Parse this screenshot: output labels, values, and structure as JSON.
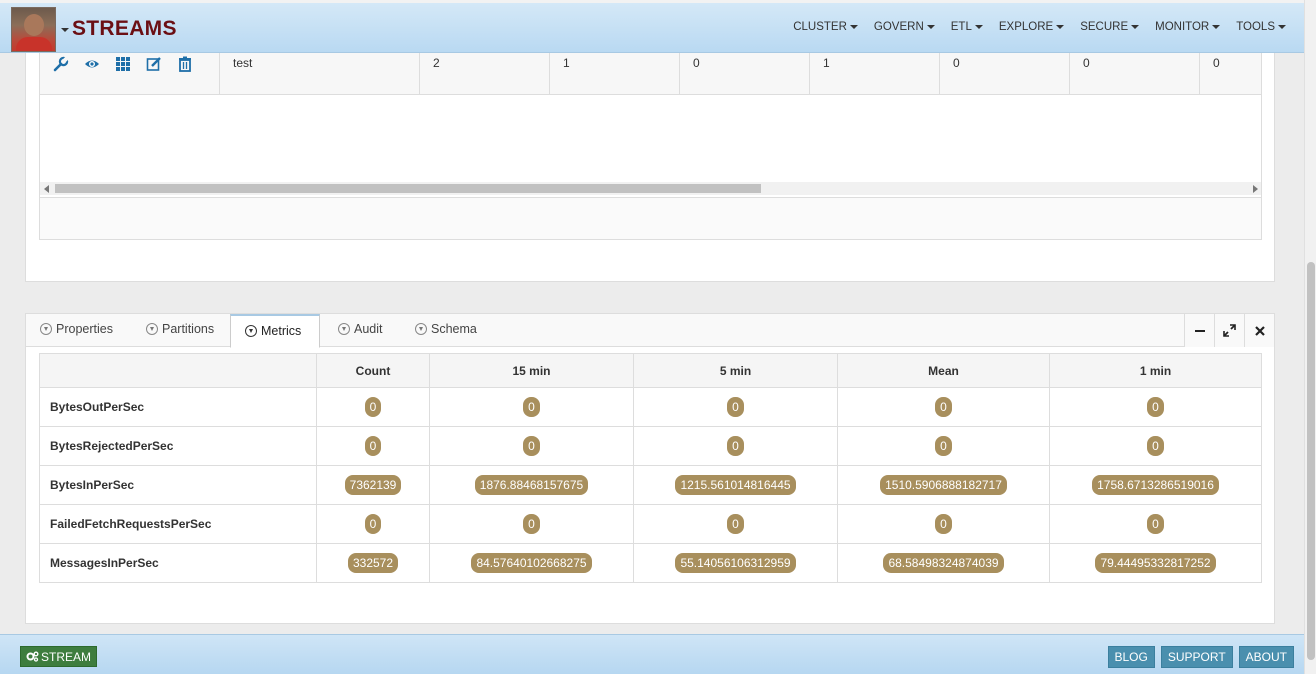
{
  "header": {
    "brand": "STREAMS",
    "menu": [
      {
        "label": "CLUSTER"
      },
      {
        "label": "GOVERN"
      },
      {
        "label": "ETL"
      },
      {
        "label": "EXPLORE"
      },
      {
        "label": "SECURE"
      },
      {
        "label": "MONITOR"
      },
      {
        "label": "TOOLS"
      }
    ]
  },
  "topics_table": {
    "row": {
      "name": "test",
      "values": [
        "2",
        "1",
        "0",
        "1",
        "0",
        "0",
        "0"
      ]
    },
    "action_icons": [
      "wrench-icon",
      "eye-icon",
      "grid-icon",
      "edit-icon",
      "trash-icon"
    ]
  },
  "tabs": [
    {
      "label": "Properties",
      "active": false
    },
    {
      "label": "Partitions",
      "active": false
    },
    {
      "label": "Metrics",
      "active": true
    },
    {
      "label": "Audit",
      "active": false
    },
    {
      "label": "Schema",
      "active": false
    }
  ],
  "metrics": {
    "columns": [
      "",
      "Count",
      "15 min",
      "5 min",
      "Mean",
      "1 min"
    ],
    "rows": [
      {
        "name": "BytesOutPerSec",
        "values": [
          "0",
          "0",
          "0",
          "0",
          "0"
        ]
      },
      {
        "name": "BytesRejectedPerSec",
        "values": [
          "0",
          "0",
          "0",
          "0",
          "0"
        ]
      },
      {
        "name": "BytesInPerSec",
        "values": [
          "7362139",
          "1876.88468157675",
          "1215.561014816445",
          "1510.5906888182717",
          "1758.6713286519016"
        ]
      },
      {
        "name": "FailedFetchRequestsPerSec",
        "values": [
          "0",
          "0",
          "0",
          "0",
          "0"
        ]
      },
      {
        "name": "MessagesInPerSec",
        "values": [
          "332572",
          "84.57640102668275",
          "55.14056106312959",
          "68.58498324874039",
          "79.44495332817252"
        ]
      }
    ]
  },
  "footer": {
    "stream_button": "STREAM",
    "links": [
      "BLOG",
      "SUPPORT",
      "ABOUT"
    ]
  },
  "colors": {
    "brand": "#6b0f14",
    "badge": "#a88f5d",
    "stream_button": "#3e7d3e",
    "footer_button": "#4a8fae"
  }
}
